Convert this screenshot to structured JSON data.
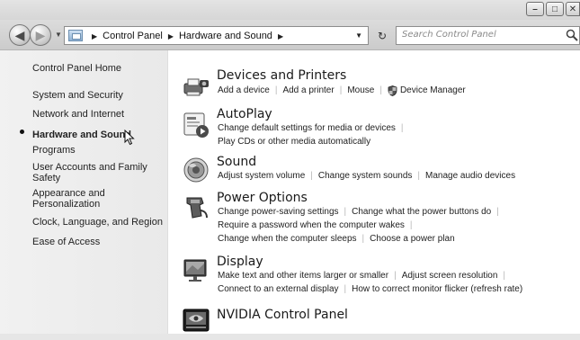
{
  "window": {
    "caption_buttons": [
      {
        "name": "minimize",
        "glyph": "–"
      },
      {
        "name": "maximize",
        "glyph": "□"
      },
      {
        "name": "close",
        "glyph": "✕"
      }
    ]
  },
  "navigation": {
    "breadcrumbs": [
      "Control Panel",
      "Hardware and Sound"
    ],
    "search_placeholder": "Search Control Panel",
    "icons": {
      "back": "back-arrow-icon",
      "forward": "forward-arrow-icon",
      "refresh": "refresh-icon",
      "search": "magnifier-icon"
    }
  },
  "sidebar": {
    "home": "Control Panel Home",
    "items": [
      {
        "label": "System and Security",
        "selected": false
      },
      {
        "label": "Network and Internet",
        "selected": false
      },
      {
        "label": "Hardware and Sound",
        "selected": true
      },
      {
        "label": "Programs",
        "selected": false
      },
      {
        "label": "User Accounts and Family Safety",
        "selected": false
      },
      {
        "label": "Appearance and Personalization",
        "selected": false
      },
      {
        "label": "Clock, Language, and Region",
        "selected": false
      },
      {
        "label": "Ease of Access",
        "selected": false
      }
    ]
  },
  "categories": [
    {
      "title": "Devices and Printers",
      "icon": "printer-camera-icon",
      "rows": [
        [
          "Add a device",
          "Add a printer",
          "Mouse",
          "Device Manager"
        ]
      ]
    },
    {
      "title": "AutoPlay",
      "icon": "autoplay-icon",
      "rows": [
        [
          "Change default settings for media or devices"
        ],
        [
          "Play CDs or other media automatically"
        ]
      ]
    },
    {
      "title": "Sound",
      "icon": "speaker-icon",
      "rows": [
        [
          "Adjust system volume",
          "Change system sounds",
          "Manage audio devices"
        ]
      ]
    },
    {
      "title": "Power Options",
      "icon": "power-plug-icon",
      "rows": [
        [
          "Change power-saving settings",
          "Change what the power buttons do"
        ],
        [
          "Require a password when the computer wakes"
        ],
        [
          "Change when the computer sleeps",
          "Choose a power plan"
        ]
      ]
    },
    {
      "title": "Display",
      "icon": "monitor-icon",
      "rows": [
        [
          "Make text and other items larger or smaller",
          "Adjust screen resolution"
        ],
        [
          "Connect to an external display",
          "How to correct monitor flicker (refresh rate)"
        ]
      ]
    },
    {
      "title": "NVIDIA Control Panel",
      "icon": "nvidia-icon",
      "rows": []
    }
  ]
}
